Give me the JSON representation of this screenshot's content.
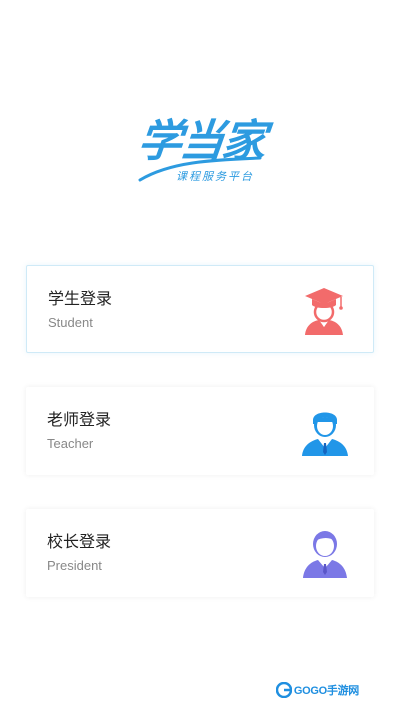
{
  "logo": {
    "title": "学当家",
    "subtitle": "课程服务平台",
    "color": "#2d9be0"
  },
  "login_options": [
    {
      "title": "学生登录",
      "subtitle": "Student",
      "icon": "student-graduate-icon",
      "icon_color": "#f26b6b"
    },
    {
      "title": "老师登录",
      "subtitle": "Teacher",
      "icon": "teacher-suit-icon",
      "icon_color": "#2196e8"
    },
    {
      "title": "校长登录",
      "subtitle": "President",
      "icon": "president-suit-icon",
      "icon_color": "#7b78e6"
    }
  ],
  "watermark": {
    "text": "GOGO手游网",
    "icon": "gogo-logo-icon",
    "color": "#1f8fe0"
  }
}
